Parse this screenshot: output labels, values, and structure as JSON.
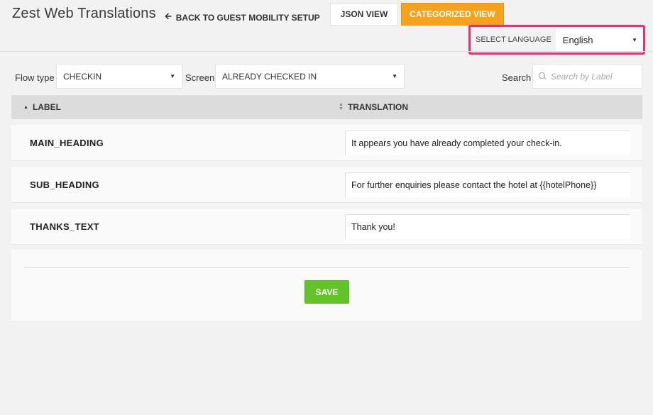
{
  "header": {
    "title": "Zest Web Translations",
    "back_link_icon": "arrow-left-icon",
    "back_link_label": "BACK TO GUEST MOBILITY SETUP",
    "view_buttons": [
      {
        "label": "JSON VIEW",
        "active": false
      },
      {
        "label": "CATEGORIZED VIEW",
        "active": true
      }
    ],
    "accent_color": "#f6a21d"
  },
  "language": {
    "label": "SELECT LANGUAGE",
    "selected": "English",
    "highlight_color": "#ee2f72"
  },
  "filters": {
    "flow_type": {
      "label": "Flow type",
      "selected": "CHECKIN"
    },
    "screen": {
      "label": "Screen",
      "selected": "ALREADY CHECKED IN"
    },
    "search": {
      "label": "Search",
      "placeholder": "Search by Label",
      "value": ""
    }
  },
  "table": {
    "columns": [
      {
        "label": "LABEL",
        "sort": "ascending"
      },
      {
        "label": "TRANSLATION",
        "sort": "none"
      }
    ],
    "rows": [
      {
        "label": "MAIN_HEADING",
        "translation": "It appears you have already completed your check-in."
      },
      {
        "label": "SUB_HEADING",
        "translation": "For further enquiries please contact the hotel at {{hotelPhone}}"
      },
      {
        "label": "THANKS_TEXT",
        "translation": "Thank you!"
      }
    ]
  },
  "footer": {
    "save_label": "SAVE",
    "save_color": "#62c427"
  }
}
